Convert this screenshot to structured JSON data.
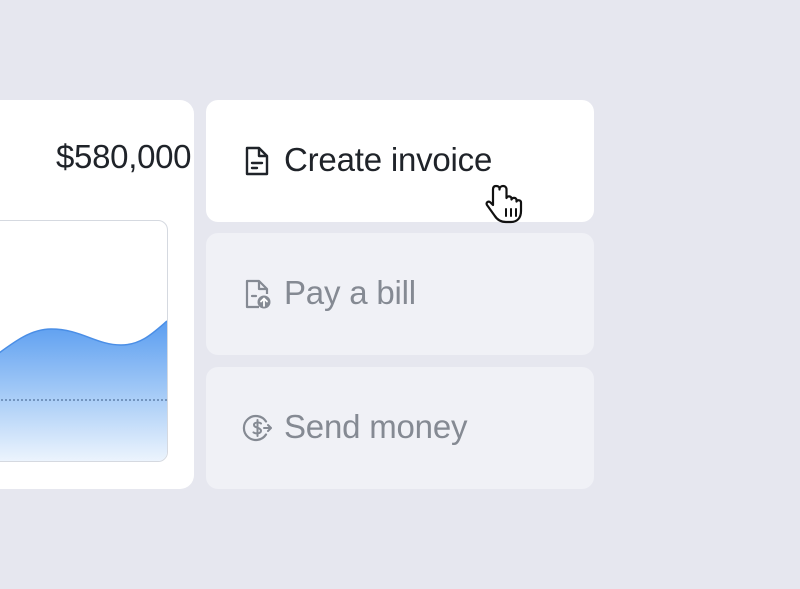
{
  "balance": {
    "amount": "$580,000"
  },
  "actions": [
    {
      "label": "Create invoice",
      "icon": "invoice-icon",
      "state": "hovered"
    },
    {
      "label": "Pay a bill",
      "icon": "bill-upload-icon",
      "state": "default"
    },
    {
      "label": "Send money",
      "icon": "send-money-icon",
      "state": "default"
    }
  ],
  "colors": {
    "background": "#e6e7ef",
    "card": "#ffffff",
    "inactive_card": "#f0f1f6",
    "chart_fill": "#5a9df0",
    "text_primary": "#1f2329",
    "text_muted": "#858a93"
  }
}
